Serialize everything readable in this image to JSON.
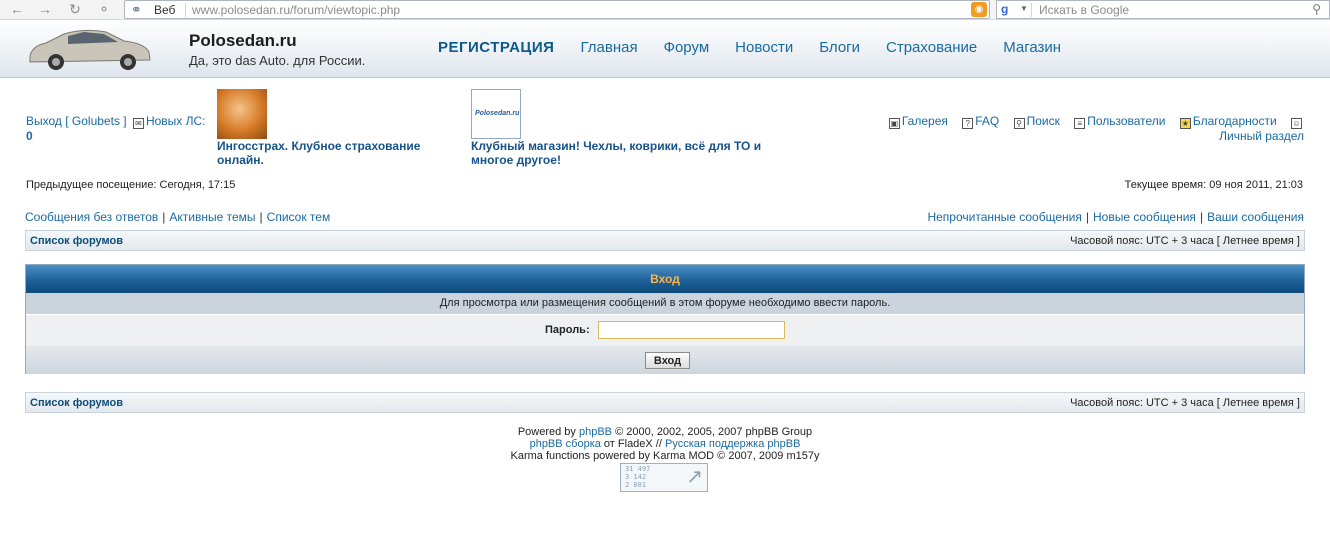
{
  "browser": {
    "engine_label": "Веб",
    "url": "www.polosedan.ru/forum/viewtopic.php",
    "search_placeholder": "Искать в Google"
  },
  "site": {
    "name": "Polosedan.ru",
    "slogan": "Да, это das Auto. для России.",
    "nav": [
      "РЕГИСТРАЦИЯ",
      "Главная",
      "Форум",
      "Новости",
      "Блоги",
      "Страхование",
      "Магазин"
    ]
  },
  "user": {
    "logout_prefix": "Выход [ ",
    "username": "Golubets",
    "logout_suffix": " ]",
    "new_pm_label": "Новых ЛС:",
    "new_pm_count": "0"
  },
  "ads": [
    {
      "text": "Ингосстрах. Клубное страхование онлайн."
    },
    {
      "text": "Клубный магазин! Чехлы, коврики, всё для ТО и многое другое!",
      "logo_text": "Polosedan.ru"
    }
  ],
  "toplinks": {
    "gallery": "Галерея",
    "faq": "FAQ",
    "search": "Поиск",
    "users": "Пользователи",
    "thanks": "Благодарности",
    "profile": "Личный раздел"
  },
  "info": {
    "last_visit": "Предыдущее посещение: Сегодня, 17:15",
    "current_time": "Текущее время: 09 ноя 2011, 21:03"
  },
  "quicklinks_left": [
    "Сообщения без ответов",
    "Активные темы",
    "Список тем"
  ],
  "quicklinks_right": [
    "Непрочитанные сообщения",
    "Новые сообщения",
    "Ваши сообщения"
  ],
  "navbar": {
    "forum_list": "Список форумов",
    "timezone": "Часовой пояс: UTC + 3 часа [ Летнее время ]"
  },
  "login": {
    "title": "Вход",
    "message": "Для просмотра или размещения сообщений в этом форуме необходимо ввести пароль.",
    "password_label": "Пароль:",
    "password_value": "",
    "submit_label": "Вход"
  },
  "footer": {
    "line1_prefix": "Powered by ",
    "line1_link": "phpBB",
    "line1_suffix": " © 2000, 2002, 2005, 2007 phpBB Group",
    "line2_link1": "phpBB сборка",
    "line2_mid": " от FladeX // ",
    "line2_link2": "Русская поддержка phpBB",
    "line3": "Karma functions powered by Karma MOD © 2007, 2009 m157y",
    "counter_lines": [
      "31 497",
      "3 142",
      "2 801"
    ]
  },
  "colors": {
    "link": "#1a6aa0",
    "login_header": "#1b5e96",
    "login_title": "#ffb54a"
  }
}
